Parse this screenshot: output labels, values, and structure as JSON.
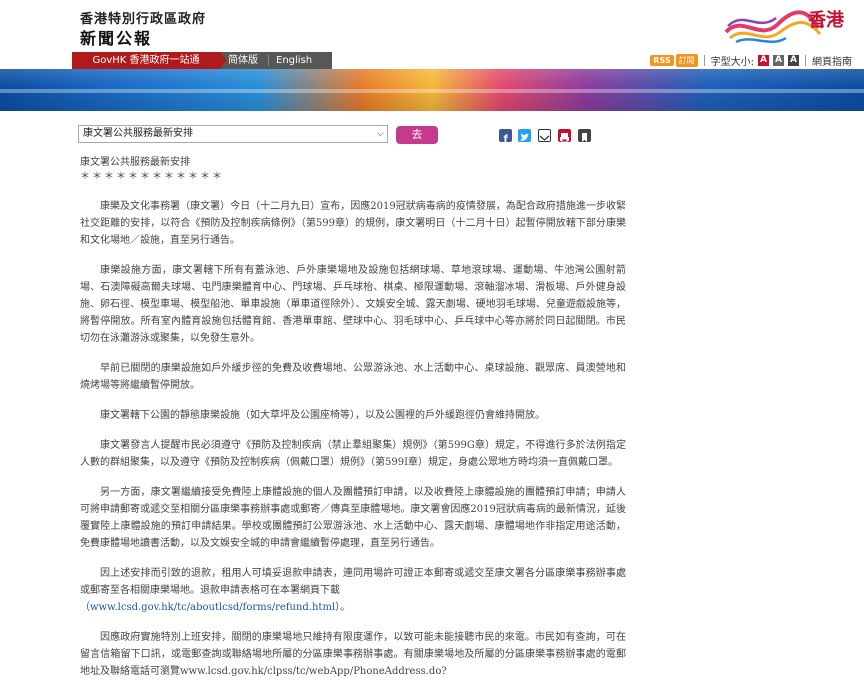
{
  "header": {
    "org": "香港特別行政區政府",
    "site_name": "新聞公報",
    "brand_text": "香港"
  },
  "nav": {
    "gov_link": "GovHK 香港政府一站通",
    "simplified": "简体版",
    "english": "English"
  },
  "tools": {
    "rss": "RSS",
    "rss_label": "訂閱",
    "font_size_label": "字型大小:",
    "font_sizes": [
      "A",
      "A",
      "A"
    ],
    "guide": "網頁指南",
    "colors": {
      "font_small": "#c8102e",
      "font_mid": "#666666",
      "font_large": "#444444"
    }
  },
  "controls": {
    "select_value": "康文署公共服務最新安排",
    "go_label": "去"
  },
  "share": [
    {
      "icon": "facebook-icon",
      "color": "#3b5998"
    },
    {
      "icon": "twitter-icon",
      "color": "#1da1f2"
    },
    {
      "icon": "email-icon",
      "color": "#333333"
    },
    {
      "icon": "print-icon",
      "color": "#c8102e"
    },
    {
      "icon": "bookmark-icon",
      "color": "#444444"
    }
  ],
  "article": {
    "title": "康文署公共服務最新安排",
    "stars": "＊＊＊＊＊＊＊＊＊＊＊＊",
    "paragraphs": [
      "康樂及文化事務署（康文署）今日（十二月九日）宣布，因應2019冠狀病毒病的疫情發展，為配合政府措施進一步收緊社交距離的安排，以符合《預防及控制疾病條例》（第599章）的規例，康文署明日（十二月十日）起暫停開放轄下部分康樂和文化場地／設施，直至另行通告。",
      "康樂設施方面，康文署轄下所有有蓋泳池、戶外康樂場地及設施包括網球場、草地滾球場、運動場、牛池灣公園射箭場、石澳障礙高爾夫球場、屯門康樂體育中心、門球場、乒乓球枱、棋桌、極限運動場、滾軸溜冰場、滑板場、戶外健身設施、卵石徑、模型車場、模型船池、單車設施（單車道徑除外）、文娛安全城、露天劇場、硬地羽毛球場、兒童遊戲設施等，將暫停開放。所有室內體育設施包括體育館、香港單車館、壁球中心、羽毛球中心、乒乓球中心等亦將於同日起關閉。市民切勿在泳灘游泳或聚集，以免發生意外。",
      "早前已關閉的康樂設施如戶外緩步徑的免費及收費場地、公眾游泳池、水上活動中心、桌球設施、觀眾席、員澳營地和燒烤場等將繼續暫停開放。",
      "康文署轄下公園的靜態康樂設施（如大草坪及公園座椅等），以及公園裡的戶外緩跑徑仍會維持開放。",
      "康文署發言人提醒市民必須遵守《預防及控制疾病（禁止羣組聚集）規例》（第599G章）規定，不得進行多於法例指定人數的群組聚集，以及遵守《預防及控制疾病（佩戴口罩）規例》（第599I章）規定，身處公眾地方時均須一直佩戴口罩。",
      "另一方面，康文署繼續接受免費陸上康體設施的個人及團體預訂申請，以及收費陸上康體設施的團體預訂申請；申請人可將申請郵寄或遞交至相關分區康樂事務辦事處或郵寄／傳真至康體場地。康文署會因應2019冠狀病毒病的最新情況，延後覆實陸上康體設施的預訂申請結果。學校或團體預訂公眾游泳池、水上活動中心、露天劇場、康體場地作非指定用途活動，免費康體場地讀書活動，以及文娛安全城的申請會繼續暫停處理，直至另行通告。",
      "因上述安排而引致的退款，租用人可填妥退款申請表，連同用場許可證正本郵寄或遞交至康文署各分區康樂事務辦事處或郵寄至各相關康樂場地。退款申請表格可在本署網頁下載",
      "（www.lcsd.gov.hk/tc/aboutlcsd/forms/refund.html）。",
      "因應政府實施特別上班安排，關閉的康樂場地只維持有限度運作，以致可能未能接聽市民的來電。市民如有查詢，可在留言信箱留下口訊，或電郵查詢或聯絡場地所屬的分區康樂事務辦事處。有關康樂場地及所屬的分區康樂事務辦事處的電郵地址及聯絡電話可瀏覽www.lcsd.gov.hk/clpss/tc/webApp/PhoneAddress.do?"
    ]
  }
}
